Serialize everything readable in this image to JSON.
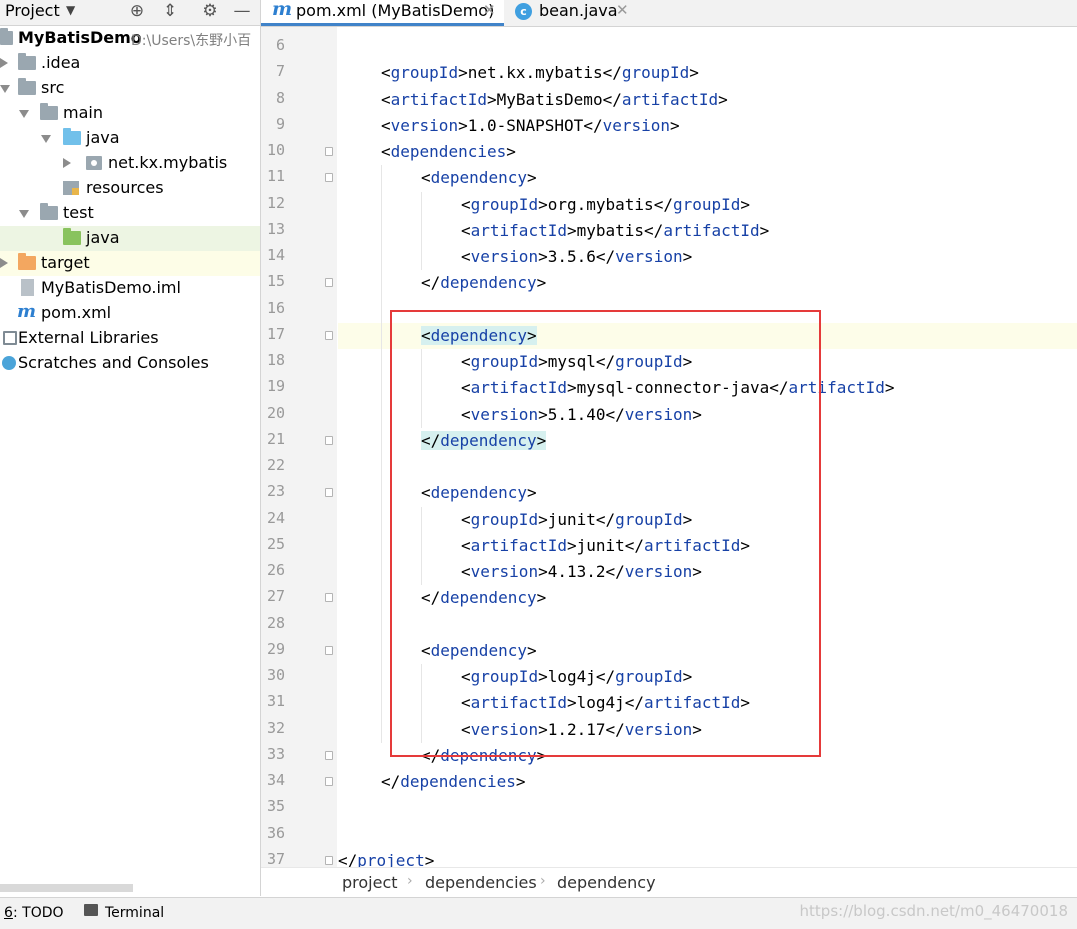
{
  "project_panel": {
    "title": "Project",
    "tree": [
      {
        "label": "MyBatisDemo",
        "hint": "D:\\Users\\东野小百"
      },
      {
        "label": ".idea"
      },
      {
        "label": "src"
      },
      {
        "label": "main"
      },
      {
        "label": "java"
      },
      {
        "label": "net.kx.mybatis"
      },
      {
        "label": "resources"
      },
      {
        "label": "test"
      },
      {
        "label": "java"
      },
      {
        "label": "target"
      },
      {
        "label": "MyBatisDemo.iml"
      },
      {
        "label": "pom.xml"
      },
      {
        "label": "External Libraries"
      },
      {
        "label": "Scratches and Consoles"
      }
    ],
    "icons": {
      "m_glyph": "m",
      "c_glyph": "c"
    }
  },
  "tabs": [
    {
      "label": "pom.xml (MyBatisDemo)"
    },
    {
      "label": "bean.java"
    }
  ],
  "editor": {
    "line_numbers": [
      "6",
      "7",
      "8",
      "9",
      "10",
      "11",
      "12",
      "13",
      "14",
      "15",
      "16",
      "17",
      "18",
      "19",
      "20",
      "21",
      "22",
      "23",
      "24",
      "25",
      "26",
      "27",
      "28",
      "29",
      "30",
      "31",
      "32",
      "33",
      "34",
      "35",
      "36",
      "37"
    ],
    "lines": [
      {
        "tag1": "",
        "text": "",
        "tag2": ""
      },
      {
        "tag1": "groupId",
        "text": "net.kx.mybatis",
        "tag2": "groupId"
      },
      {
        "tag1": "artifactId",
        "text": "MyBatisDemo",
        "tag2": "artifactId"
      },
      {
        "tag1": "version",
        "text": "1.0-SNAPSHOT",
        "tag2": "version"
      },
      {
        "tag1": "dependencies"
      },
      {
        "tag1": "dependency"
      },
      {
        "tag1": "groupId",
        "text": "org.mybatis",
        "tag2": "groupId"
      },
      {
        "tag1": "artifactId",
        "text": "mybatis",
        "tag2": "artifactId"
      },
      {
        "tag1": "version",
        "text": "3.5.6",
        "tag2": "version"
      },
      {
        "tag1": "dependency"
      },
      {},
      {
        "tag1": "dependency"
      },
      {
        "tag1": "groupId",
        "text": "mysql",
        "tag2": "groupId"
      },
      {
        "tag1": "artifactId",
        "text": "mysql-connector-java",
        "tag2": "artifactId"
      },
      {
        "tag1": "version",
        "text": "5.1.40",
        "tag2": "version"
      },
      {
        "tag1": "dependency"
      },
      {},
      {
        "tag1": "dependency"
      },
      {
        "tag1": "groupId",
        "text": "junit",
        "tag2": "groupId"
      },
      {
        "tag1": "artifactId",
        "text": "junit",
        "tag2": "artifactId"
      },
      {
        "tag1": "version",
        "text": "4.13.2",
        "tag2": "version"
      },
      {
        "tag1": "dependency"
      },
      {},
      {
        "tag1": "dependency"
      },
      {
        "tag1": "groupId",
        "text": "log4j",
        "tag2": "groupId"
      },
      {
        "tag1": "artifactId",
        "text": "log4j",
        "tag2": "artifactId"
      },
      {
        "tag1": "version",
        "text": "1.2.17",
        "tag2": "version"
      },
      {
        "tag1": "dependency"
      },
      {
        "tag1": "dependencies"
      },
      {},
      {},
      {
        "tag1": "project"
      }
    ],
    "glyphs": {
      "lt": "<",
      "gt": ">",
      "lt_slash": "</"
    }
  },
  "breadcrumb": [
    "project",
    "dependencies",
    "dependency"
  ],
  "status_bar": {
    "todo_num": "6",
    "todo_label": ": TODO",
    "terminal_label": "Terminal",
    "watermark": "https://blog.csdn.net/m0_46470018"
  },
  "colors": {
    "tag": "#1741a6",
    "accent": "#4083c9",
    "annotation": "#e53a3a"
  }
}
